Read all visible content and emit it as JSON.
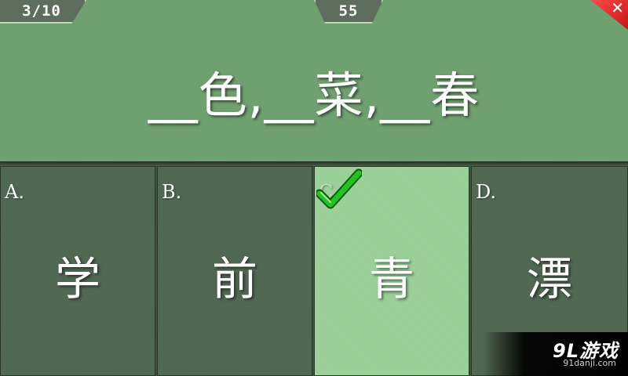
{
  "header": {
    "progress": "3/10",
    "timer": "55",
    "close_icon": "close-icon"
  },
  "question": {
    "text": "__色,__菜,__春"
  },
  "options": [
    {
      "letter": "A.",
      "char": "学",
      "state": "normal"
    },
    {
      "letter": "B.",
      "char": "前",
      "state": "normal"
    },
    {
      "letter": "C.",
      "char": "青",
      "state": "correct"
    },
    {
      "letter": "D.",
      "char": "漂",
      "state": "normal"
    }
  ],
  "watermark": {
    "logo": "9L游戏",
    "url": "91danji.com"
  },
  "colors": {
    "top_panel": "#6e9f6e",
    "option_normal": "#4f6650",
    "option_correct": "#99cf97",
    "check_green": "#22c322",
    "close_red": "#e02020"
  }
}
